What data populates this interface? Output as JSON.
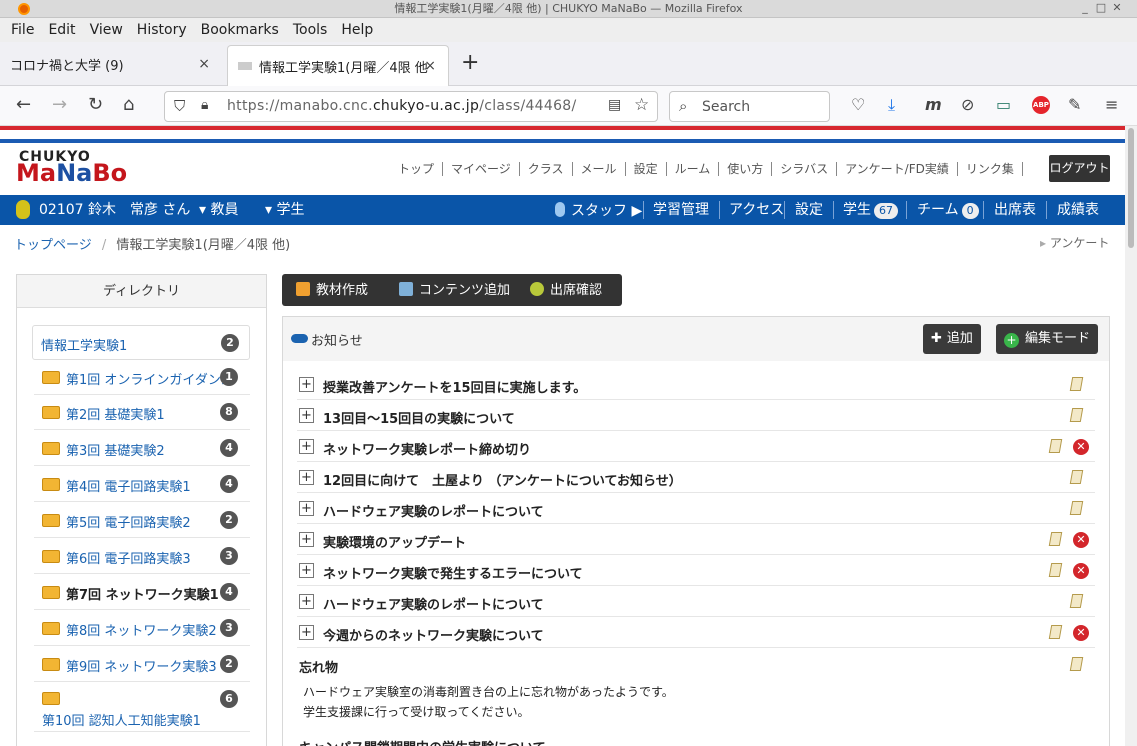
{
  "window": {
    "title": "情報工学実験1(月曜／4限 他) | CHUKYO MaNaBo — Mozilla Firefox"
  },
  "menu": [
    "File",
    "Edit",
    "View",
    "History",
    "Bookmarks",
    "Tools",
    "Help"
  ],
  "tabs": [
    {
      "label": "コロナ禍と大学 (9)",
      "close": "×"
    },
    {
      "label": "情報工学実験1(月曜／4限 他",
      "close": "×"
    }
  ],
  "newtab": "+",
  "url": {
    "prefix": "https://manabo.cnc.",
    "domain": "chukyo-u.ac.jp",
    "path": "/class/44468/"
  },
  "search": {
    "placeholder": "Search"
  },
  "logo": {
    "top": "CHUKYO",
    "ma": "Ma",
    "na": "Na",
    "bo": "Bo"
  },
  "sitenav": [
    "トップ",
    "マイページ",
    "クラス",
    "メール",
    "設定",
    "ルーム",
    "使い方",
    "シラバス",
    "アンケート/FD実績",
    "リンク集"
  ],
  "logout": "ログアウト",
  "userbar": {
    "user": "02107 鈴木　常彦 さん",
    "role1": "教員",
    "role2": "学生",
    "staff": "スタッフ",
    "items": [
      "学習管理",
      "アクセス",
      "設定"
    ],
    "students": "学生",
    "students_count": "67",
    "team": "チーム",
    "team_count": "0",
    "attendance": "出席表",
    "grades": "成績表"
  },
  "breadcrumb": {
    "home": "トップページ",
    "sep": "/",
    "current": "情報工学実験1(月曜／4限 他)",
    "right": "アンケート"
  },
  "directory": {
    "title": "ディレクトリ",
    "root": {
      "label": "情報工学実験1",
      "count": "2"
    },
    "items": [
      {
        "label": "第1回 オンラインガイダンス",
        "count": "1"
      },
      {
        "label": "第2回 基礎実験1",
        "count": "8"
      },
      {
        "label": "第3回 基礎実験2",
        "count": "4"
      },
      {
        "label": "第4回 電子回路実験1",
        "count": "4"
      },
      {
        "label": "第5回 電子回路実験2",
        "count": "2"
      },
      {
        "label": "第6回 電子回路実験3",
        "count": "3"
      },
      {
        "label": "第7回 ネットワーク実験1",
        "count": "4"
      },
      {
        "label": "第8回 ネットワーク実験2",
        "count": "3"
      },
      {
        "label": "第9回 ネットワーク実験3",
        "count": "2"
      },
      {
        "label": "第10回 認知人工知能実験1",
        "count": "6"
      }
    ]
  },
  "toolbar": {
    "create": "教材作成",
    "add_content": "コンテンツ追加",
    "attendance": "出席確認"
  },
  "news": {
    "title": "お知らせ",
    "add": "追加",
    "edit_mode": "編集モード",
    "rows": [
      {
        "text": "授業改善アンケートを15回目に実施します。"
      },
      {
        "text": "13回目～15回目の実験について"
      },
      {
        "text": "ネットワーク実験レポート締め切り"
      },
      {
        "text": "12回目に向けて　土屋より （アンケートについてお知らせ）"
      },
      {
        "text": "ハードウェア実験のレポートについて"
      },
      {
        "text": "実験環境のアップデート"
      },
      {
        "text": "ネットワーク実験で発生するエラーについて"
      },
      {
        "text": "ハードウェア実験のレポートについて"
      },
      {
        "text": "今週からのネットワーク実験について"
      }
    ],
    "memo": {
      "title": "忘れ物",
      "line1": "ハードウェア実験室の消毒剤置き台の上に忘れ物があったようです。",
      "line2": "学生支援課に行って受け取ってください。"
    },
    "next_title": "キャンパス閉鎖期間中の学生実験について"
  }
}
